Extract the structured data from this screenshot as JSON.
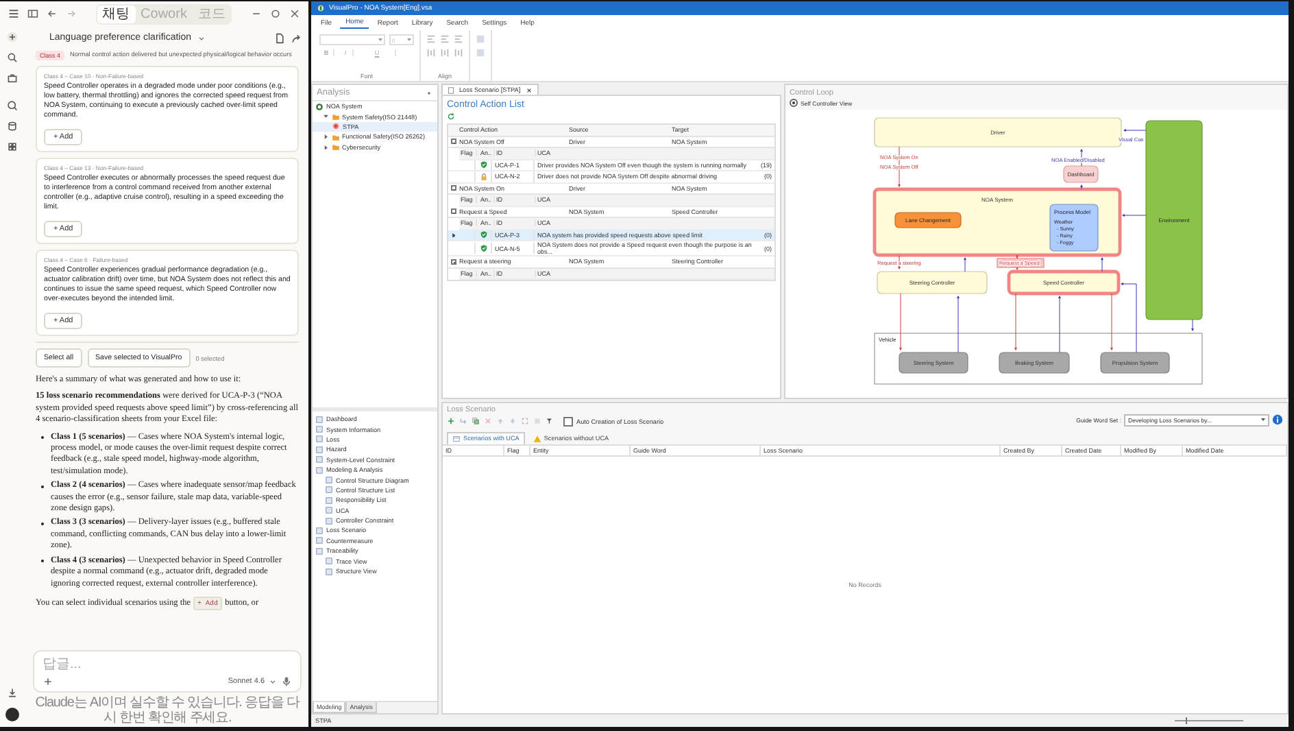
{
  "chat_app": {
    "mode_tabs": [
      {
        "label": "채팅",
        "selected": true
      },
      {
        "label": "Cowork",
        "selected": false
      },
      {
        "label": "코드",
        "selected": false
      }
    ],
    "conversation_title": "Language preference clarification",
    "class_note": {
      "tag": "Class 4",
      "text": "Normal control action delivered but unexpected physical/logical behavior occurs"
    },
    "scenario_cards": [
      {
        "label": "Class 4 – Case 10 · Non-Failure-based",
        "text": "Speed Controller operates in a degraded mode under poor conditions (e.g., low battery, thermal throttling) and ignores the corrected speed request from NOA System, continuing to execute a previously cached over-limit speed command.",
        "button": "+ Add"
      },
      {
        "label": "Class 4 – Case 13 · Non-Failure-based",
        "text": "Speed Controller executes or abnormally processes the speed request due to interference from a control command received from another external controller (e.g., adaptive cruise control), resulting in a speed exceeding the limit.",
        "button": "+ Add"
      },
      {
        "label": "Class 4 – Case 6 · Failure-based",
        "text": "Speed Controller experiences gradual performance degradation (e.g., actuator calibration drift) over time, but NOA System does not reflect this and continues to issue the same speed request, which Speed Controller now over-executes beyond the intended limit.",
        "button": "+ Add"
      }
    ],
    "actions": {
      "select_all": "Select all",
      "save": "Save selected to VisualPro",
      "selected_count": "0 selected"
    },
    "summary": {
      "intro": "Here's a summary of what was generated and how to use it:",
      "lead": "**15 loss scenario recommendations** were derived for UCA-P-3 (“NOA system provided speed requests above speed limit”) by cross-referencing all 4 scenario-classification sheets from your Excel file:",
      "bullets": [
        "**Class 1 (5 scenarios)** — Cases where NOA System's internal logic, process model, or mode causes the over-limit request despite correct feedback (e.g., stale speed model, highway-mode algorithm, test/simulation mode).",
        "**Class 2 (4 scenarios)** — Cases where inadequate sensor/map feedback causes the error (e.g., sensor failure, stale map data, variable-speed zone design gaps).",
        "**Class 3 (3 scenarios)** — Delivery-layer issues (e.g., buffered stale command, conflicting commands, CAN bus delay into a lower-limit zone).",
        "**Class 4 (3 scenarios)** — Unexpected behavior in Speed Controller despite a normal command (e.g., actuator drift, degraded mode ignoring corrected request, external controller interference)."
      ],
      "closing": {
        "before": "You can select individual scenarios using the",
        "code": "+ Add",
        "after": "button, or"
      }
    },
    "composer": {
      "placeholder": "답글...",
      "model": "Sonnet 4.6"
    },
    "disclaimer": "Claude는 AI이며 실수할 수 있습니다. 응답을 다시 한번 확인해 주세요."
  },
  "visualpro": {
    "window": {
      "title": "VisualPro - NOA System[Eng].vsa"
    },
    "menu": [
      {
        "label": "File",
        "selected": false
      },
      {
        "label": "Home",
        "selected": true
      },
      {
        "label": "Report",
        "selected": false
      },
      {
        "label": "Library",
        "selected": false
      },
      {
        "label": "Search",
        "selected": false
      },
      {
        "label": "Settings",
        "selected": false
      },
      {
        "label": "Help",
        "selected": false
      }
    ],
    "ribbon": {
      "font_size": "0",
      "styles": [
        "B",
        "I",
        "U"
      ],
      "groups": [
        "Font",
        "Align"
      ]
    },
    "analysis_panel": {
      "title": "Analysis",
      "tree": [
        {
          "label": "NOA System",
          "kind": "root",
          "selected": false,
          "children": [
            {
              "label": "System Safety(ISO 21448)",
              "kind": "folder",
              "selected": false,
              "expanded": true,
              "children": [
                {
                  "label": "STPA",
                  "kind": "method",
                  "selected": true
                }
              ]
            },
            {
              "label": "Functional Safety(ISO 26262)",
              "kind": "folder",
              "selected": false,
              "expanded": false
            },
            {
              "label": "Cybersecurity",
              "kind": "folder",
              "selected": false,
              "expanded": false
            }
          ]
        }
      ],
      "navigation": [
        {
          "label": "Dashboard",
          "selected": false
        },
        {
          "label": "System Information",
          "selected": false
        },
        {
          "label": "Loss",
          "selected": false
        },
        {
          "label": "Hazard",
          "selected": false
        },
        {
          "label": "System-Level Constraint",
          "selected": false
        },
        {
          "label": "Modeling & Analysis",
          "selected": false,
          "children": [
            {
              "label": "Control Structure Diagram",
              "selected": false
            },
            {
              "label": "Control Structure List",
              "selected": false
            },
            {
              "label": "Responsibility List",
              "selected": false
            },
            {
              "label": "UCA",
              "selected": false
            },
            {
              "label": "Controller Constraint",
              "selected": false
            }
          ]
        },
        {
          "label": "Loss Scenario",
          "selected": false
        },
        {
          "label": "Countermeasure",
          "selected": false
        },
        {
          "label": "Traceability",
          "selected": false,
          "children": [
            {
              "label": "Trace View",
              "selected": false
            },
            {
              "label": "Structure View",
              "selected": false
            }
          ]
        }
      ],
      "bottom_tabs": [
        {
          "label": "Modeling",
          "selected": true
        },
        {
          "label": "Analysis",
          "selected": false
        }
      ]
    },
    "document_tab": {
      "label": "Loss Scenario [STPA]"
    },
    "control_action_list": {
      "title": "Control Action List",
      "columns": [
        "Control Action",
        "Source",
        "Target"
      ],
      "groups": [
        {
          "action": "NOA System Off",
          "source": "Driver",
          "target": "NOA System",
          "expanded": true,
          "columns": [
            "Flag",
            "An..",
            "ID",
            "UCA"
          ],
          "ucas": [
            {
              "id": "UCA-P-1",
              "text": "Driver provides NOA System Off even though the system is running normally",
              "count": "(19)",
              "kind": "verified",
              "selected": false
            },
            {
              "id": "UCA-N-2",
              "text": "Driver does not provide NOA System Off despite abnormal driving",
              "count": "(0)",
              "kind": "locked",
              "selected": false
            }
          ]
        },
        {
          "action": "NOA System On",
          "source": "Driver",
          "target": "NOA System",
          "expanded": true,
          "columns": [
            "Flag",
            "An..",
            "ID",
            "UCA"
          ]
        },
        {
          "action": "Request a Speed",
          "source": "NOA System",
          "target": "Speed Controller",
          "expanded": true,
          "columns": [
            "Flag",
            "An..",
            "ID",
            "UCA"
          ],
          "ucas": [
            {
              "id": "UCA-P-3",
              "text": "NOA system has provided speed requests above speed limit",
              "count": "(0)",
              "kind": "verified",
              "selected": true
            },
            {
              "id": "UCA-N-5",
              "text": "NOA System does not provide a Speed  request even though the purpose is an obs...",
              "count": "(0)",
              "kind": "verified",
              "selected": false
            }
          ]
        },
        {
          "action": "Request a steering",
          "source": "NOA System",
          "target": "Steering Controller",
          "expanded": true,
          "columns": [
            "Flag",
            "An..",
            "ID",
            "UCA"
          ]
        }
      ]
    },
    "control_loop": {
      "title": "Control Loop",
      "view_option": {
        "label": "Self Controller View",
        "selected": true
      },
      "nodes": [
        {
          "label": "Driver",
          "kind": "controller",
          "highlighted": false
        },
        {
          "label": "Environment",
          "kind": "environment",
          "highlighted": false
        },
        {
          "label": "Dashboard",
          "kind": "display",
          "highlighted": false
        },
        {
          "label": "NOA System",
          "kind": "controller",
          "highlighted": true
        },
        {
          "label": "Lane Changement",
          "kind": "component",
          "highlighted": false
        },
        {
          "label": "Process Model",
          "kind": "process_model",
          "highlighted": false,
          "lines": [
            "Weather",
            "- Sunny",
            "- Rainy",
            "- Foggy"
          ]
        },
        {
          "label": "Steering Controller",
          "kind": "controller",
          "highlighted": false
        },
        {
          "label": "Speed Controller",
          "kind": "controller",
          "highlighted": true
        },
        {
          "label": "Vehicle",
          "kind": "container",
          "highlighted": false
        },
        {
          "label": "Steering System",
          "kind": "actuator",
          "highlighted": false
        },
        {
          "label": "Braking System",
          "kind": "actuator",
          "highlighted": false
        },
        {
          "label": "Propulsion System",
          "kind": "actuator",
          "highlighted": false
        }
      ],
      "signal_labels": [
        {
          "text": "NOA System On",
          "kind": "control",
          "highlighted": false
        },
        {
          "text": "NOA System Off",
          "kind": "control",
          "highlighted": false
        },
        {
          "text": "NOA Enabled/Disabled",
          "kind": "feedback",
          "highlighted": false
        },
        {
          "text": "Visual Cue",
          "kind": "feedback",
          "highlighted": false
        },
        {
          "text": "Request a steering",
          "kind": "control",
          "highlighted": false
        },
        {
          "text": "Request a Speed",
          "kind": "control",
          "highlighted": true
        }
      ]
    },
    "loss_scenario": {
      "title": "Loss Scenario",
      "auto_create": {
        "label": "Auto Creation of Loss Scenario",
        "checked": false
      },
      "guide_word_set": {
        "label": "Guide Word Set :",
        "value": "Developing Loss Scenarios by..."
      },
      "tabs": [
        {
          "label": "Scenarios with UCA",
          "selected": true
        },
        {
          "label": "Scenarios without UCA",
          "selected": false
        }
      ],
      "columns": [
        "ID",
        "Flag",
        "Entity",
        "Guide Word",
        "Loss Scenario",
        "Created By",
        "Created Date",
        "Modified By",
        "Modified Date"
      ],
      "empty_text": "No Records"
    },
    "status_bar": {
      "text": "STPA",
      "zoom": {
        "level": 0.15
      }
    }
  }
}
